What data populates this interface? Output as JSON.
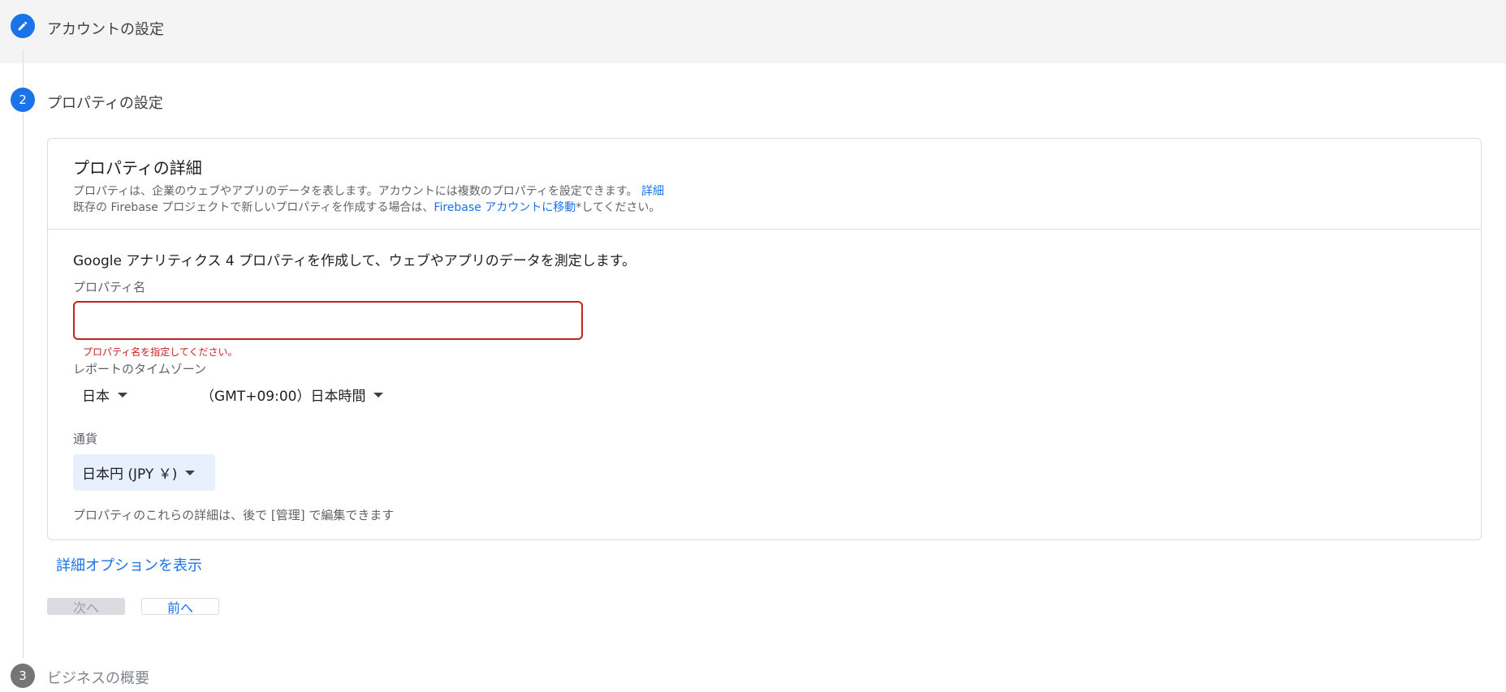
{
  "steps": [
    {
      "number": "",
      "title": "アカウントの設定"
    },
    {
      "number": "2",
      "title": "プロパティの設定"
    },
    {
      "number": "3",
      "title": "ビジネスの概要"
    }
  ],
  "card": {
    "title": "プロパティの詳細",
    "desc_line1": "プロパティは、企業のウェブやアプリのデータを表します。アカウントには複数のプロパティを設定できます。",
    "desc_line1_link": "詳細",
    "desc_line2_pre": "既存の Firebase プロジェクトで新しいプロパティを作成する場合は、",
    "desc_line2_link": "Firebase アカウントに移動",
    "desc_line2_post": "*してください。",
    "intro": "Google アナリティクス 4 プロパティを作成して、ウェブやアプリのデータを測定します。",
    "property_name_label": "プロパティ名",
    "property_name_value": "",
    "property_name_error": "プロパティ名を指定してください。",
    "timezone_label": "レポートのタイムゾーン",
    "country": "日本",
    "timezone": "（GMT+09:00）日本時間",
    "currency_label": "通貨",
    "currency": "日本円 (JPY ￥)",
    "note": "プロパティのこれらの詳細は、後で [管理] で編集できます"
  },
  "show_options": "詳細オプションを表示",
  "buttons": {
    "next": "次へ",
    "prev": "前へ"
  },
  "colors": {
    "accent": "#1a73e8",
    "error": "#c5221f",
    "completed_step_bg": "#f4f4f4"
  }
}
